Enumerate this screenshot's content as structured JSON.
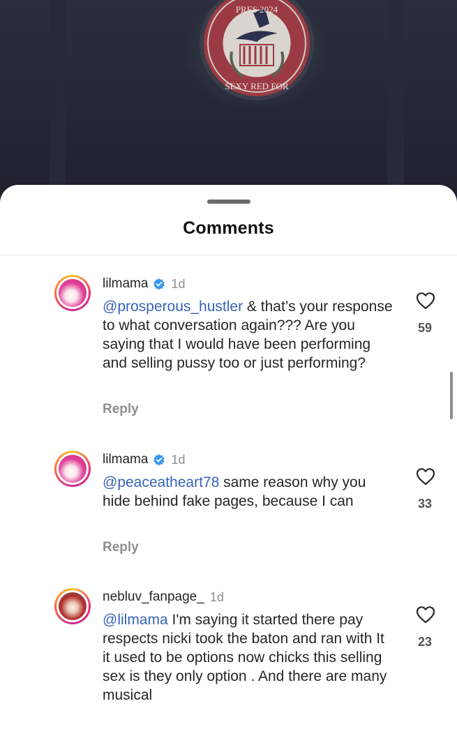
{
  "backdrop": {
    "seal_top_text": "PRES  2024",
    "seal_bottom_text": "SEXY RED FOR"
  },
  "sheet": {
    "title": "Comments"
  },
  "comments": [
    {
      "username": "lilmama",
      "verified": true,
      "time": "1d",
      "mention": "@prosperous_hustler",
      "text": " & that’s your response to what conversation again??? Are you saying that I would have been performing and selling pussy too or just performing?",
      "reply": "Reply",
      "likes": "59",
      "avatar": "pink-avatar"
    },
    {
      "username": "lilmama",
      "verified": true,
      "time": "1d",
      "mention": "@peaceatheart78",
      "text": " same reason why you hide behind fake pages, because I can",
      "reply": "Reply",
      "likes": "33",
      "avatar": "pink-avatar"
    },
    {
      "username": "nebluv_fanpage_",
      "verified": false,
      "time": "1d",
      "mention": "@lilmama",
      "text": " I'm saying it started there pay respects nicki took the baton and ran with It it used to be options now chicks this selling sex is they only option . And there are many musical",
      "reply": "",
      "likes": "23",
      "avatar": "red-avatar"
    }
  ],
  "icons": {
    "verified": "verified-badge-icon",
    "like": "heart-outline-icon"
  },
  "colors": {
    "mention": "#3763b8",
    "verified": "#3797f0",
    "muted": "#8e8e8e"
  }
}
